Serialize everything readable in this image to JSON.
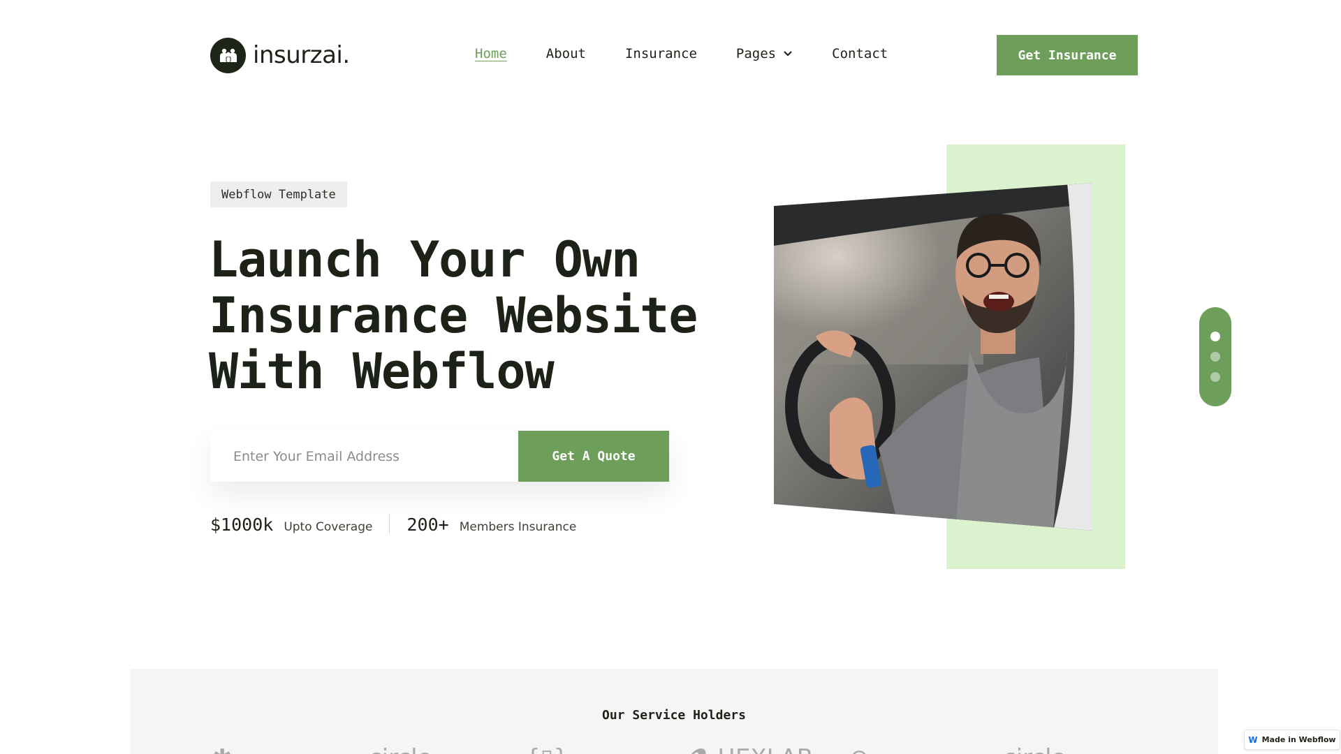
{
  "header": {
    "logo_text": "insurzai.",
    "nav": [
      {
        "label": "Home",
        "active": true
      },
      {
        "label": "About"
      },
      {
        "label": "Insurance"
      },
      {
        "label": "Pages",
        "has_dropdown": true
      },
      {
        "label": "Contact"
      }
    ],
    "cta_label": "Get Insurance"
  },
  "hero": {
    "badge": "Webflow Template",
    "title": "Launch Your Own Insurance Website With Webflow",
    "email_placeholder": "Enter Your Email Address",
    "quote_button": "Get A Quote",
    "stats": [
      {
        "value": "$1000k",
        "label": "Upto Coverage"
      },
      {
        "value": "200+",
        "label": "Members Insurance"
      }
    ],
    "slider": {
      "count": 3,
      "active_index": 0
    }
  },
  "holders": {
    "title": "Our Service Holders",
    "brands": [
      "✱",
      "circle",
      "{▯}",
      "⚗ HEXLAB",
      "⊙ ·",
      "circle"
    ]
  },
  "webflow_badge": "Made in Webflow",
  "colors": {
    "accent": "#6e9f5a",
    "accent_light": "#dbf2cf",
    "text": "#1d2218",
    "section_bg": "#f5f5f5"
  },
  "icons": {
    "logo": "family-icon",
    "pages_dropdown": "chevron-down-icon",
    "webflow": "webflow-icon"
  }
}
